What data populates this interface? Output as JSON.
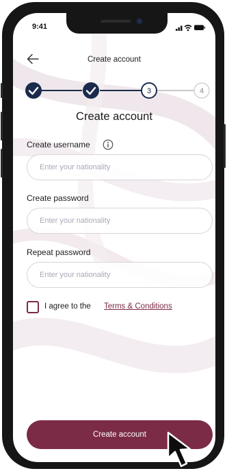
{
  "status_bar": {
    "time": "9:41"
  },
  "header": {
    "title": "Create account"
  },
  "stepper": {
    "steps": [
      {
        "label": "",
        "state": "done"
      },
      {
        "label": "",
        "state": "done"
      },
      {
        "label": "3",
        "state": "current"
      },
      {
        "label": "4",
        "state": "upcoming"
      }
    ],
    "completed_color": "#1b2b4b",
    "upcoming_color": "#c8c8c8"
  },
  "form": {
    "heading": "Create account",
    "username_label": "Create username",
    "username_placeholder": "Enter your nationality",
    "password_label": "Create password",
    "password_placeholder": "Enter your nationality",
    "repeat_label": "Repeat password",
    "repeat_placeholder": "Enter your nationality",
    "agree_text": "I agree to the",
    "terms_link": "Terms & Conditions",
    "agree_checked": false
  },
  "actions": {
    "submit_label": "Create account"
  },
  "colors": {
    "brand": "#7b2b45",
    "navy": "#1b2b4b"
  },
  "icons": {
    "back": "arrow-left-icon",
    "info": "info-icon",
    "check": "check-icon",
    "cursor": "mouse-pointer-icon"
  }
}
